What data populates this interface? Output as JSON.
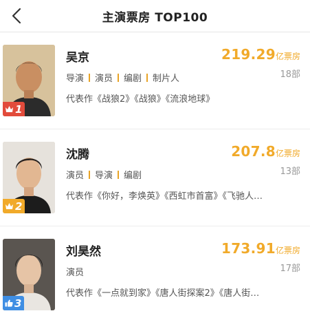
{
  "header": {
    "title": "主演票房 TOP100",
    "back_icon": "chevron-left-icon"
  },
  "colors": {
    "accent": "#f1aa2a",
    "rank_first": "#e24b3b",
    "rank_second": "#f1aa2a",
    "rank_third": "#3f8ee3"
  },
  "actors": [
    {
      "rank": "1",
      "name": "吴京",
      "box_office": "219.29",
      "unit": "亿票房",
      "count": "18部",
      "roles": [
        "导演",
        "演员",
        "编剧",
        "制片人"
      ],
      "works": "代表作《战狼2》《战狼》《流浪地球》"
    },
    {
      "rank": "2",
      "name": "沈腾",
      "box_office": "207.8",
      "unit": "亿票房",
      "count": "13部",
      "roles": [
        "演员",
        "导演",
        "编剧"
      ],
      "works": "代表作《你好，李焕英》《西虹市首富》《飞驰人…"
    },
    {
      "rank": "3",
      "name": "刘昊然",
      "box_office": "173.91",
      "unit": "亿票房",
      "count": "17部",
      "roles": [
        "演员"
      ],
      "works": "代表作《一点就到家》《唐人街探案2》《唐人街…"
    }
  ]
}
